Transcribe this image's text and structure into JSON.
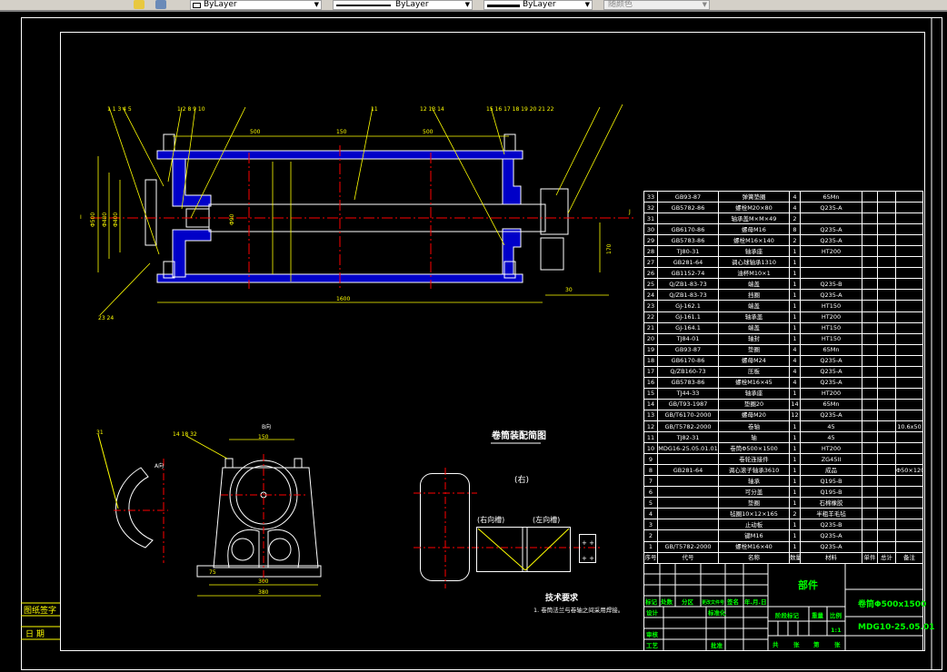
{
  "toolbar": {
    "layer_color": "ByLayer",
    "linetype": "ByLayer",
    "lineweight": "ByLayer",
    "plot_style": "随颜色"
  },
  "side_stamp": {
    "sign_label": "图纸签字",
    "date_label": "日 期"
  },
  "main_view": {
    "dims": {
      "left_half": "500",
      "mid": "150",
      "right_half": "500",
      "overall": "1600",
      "d1": "Φ500",
      "d2": "Φ480",
      "d3": "Φ400",
      "shaft": "Φ90",
      "right_len": "30",
      "right_h": "170"
    },
    "section_marks": {
      "left": "I",
      "right": "J"
    }
  },
  "bearing_view": {
    "title": "B向",
    "balloons": "14 18 32",
    "dim_top": "150",
    "dim_inner": "300",
    "dim_outer": "380",
    "dim_foot": "75"
  },
  "arc_view": {
    "balloon": "31",
    "label": "A向"
  },
  "assembly_sketch": {
    "title": "卷筒装配简图",
    "side": "(右)",
    "right_groove": "(右向槽)",
    "left_groove": "(左向槽)"
  },
  "tech_requirements": {
    "title": "技术要求",
    "items": [
      "1. 卷筒法兰与卷轴之间采用焊接。"
    ]
  },
  "parts_table": {
    "header": [
      "序号",
      "代号",
      "名称",
      "数量",
      "材料",
      "单件",
      "总计",
      "备注"
    ],
    "header_weight": "重量",
    "rows": [
      [
        "33",
        "GB93-87",
        "弹簧垫圈",
        "4",
        "65Mn",
        "",
        "",
        ""
      ],
      [
        "32",
        "GB5782-86",
        "螺栓M20×80",
        "4",
        "Q235-A",
        "",
        "",
        ""
      ],
      [
        "31",
        "",
        "轴承盖M×M×49",
        "2",
        "",
        "",
        "",
        ""
      ],
      [
        "30",
        "GB6170-86",
        "螺母M16",
        "8",
        "Q235-A",
        "",
        "",
        ""
      ],
      [
        "29",
        "GB5783-86",
        "螺栓M16×140",
        "2",
        "Q235-A",
        "",
        "",
        ""
      ],
      [
        "28",
        "TJ80-31",
        "轴承座",
        "1",
        "HT200",
        "",
        "",
        ""
      ],
      [
        "27",
        "GB281-64",
        "调心球轴承1310",
        "1",
        "",
        "",
        "",
        ""
      ],
      [
        "26",
        "GB1152-74",
        "油杯M10×1",
        "1",
        "",
        "",
        "",
        ""
      ],
      [
        "25",
        "Q/ZB1-83-73",
        "端盖",
        "1",
        "Q235-B",
        "",
        "",
        ""
      ],
      [
        "24",
        "Q/ZB1-83-73",
        "挡圈",
        "1",
        "Q235-A",
        "",
        "",
        ""
      ],
      [
        "23",
        "GJ-162.1",
        "端盖",
        "1",
        "HT150",
        "",
        "",
        ""
      ],
      [
        "22",
        "GJ-161.1",
        "轴承盖",
        "1",
        "HT200",
        "",
        "",
        ""
      ],
      [
        "21",
        "GJ-164.1",
        "端盖",
        "1",
        "HT150",
        "",
        "",
        ""
      ],
      [
        "20",
        "TJ84-01",
        "轴封",
        "1",
        "HT150",
        "",
        "",
        ""
      ],
      [
        "19",
        "GB93-87",
        "垫圈",
        "4",
        "65Mn",
        "",
        "",
        ""
      ],
      [
        "18",
        "GB6170-86",
        "螺母M24",
        "4",
        "Q235-A",
        "",
        "",
        ""
      ],
      [
        "17",
        "Q/ZB160-73",
        "压板",
        "4",
        "Q235-A",
        "",
        "",
        ""
      ],
      [
        "16",
        "GB5783-86",
        "螺栓M16×45",
        "4",
        "Q235-A",
        "",
        "",
        ""
      ],
      [
        "15",
        "TJ44-33",
        "轴承座",
        "1",
        "HT200",
        "",
        "",
        ""
      ],
      [
        "14",
        "GB/T93-1987",
        "垫圈20",
        "14",
        "65Mn",
        "",
        "",
        ""
      ],
      [
        "13",
        "GB/T6170-2000",
        "螺母M20",
        "12",
        "Q235-A",
        "",
        "",
        ""
      ],
      [
        "12",
        "GB/T5782-2000",
        "卷轴",
        "1",
        "45",
        "",
        "",
        "10.6x50"
      ],
      [
        "11",
        "TJ82-31",
        "轴",
        "1",
        "45",
        "",
        "",
        ""
      ],
      [
        "10",
        "MDG16-25.05.01.01",
        "卷筒Φ500×1500",
        "1",
        "HT200",
        "",
        "",
        ""
      ],
      [
        "9",
        "",
        "卷轮连接件",
        "1",
        "ZG45II",
        "",
        "",
        ""
      ],
      [
        "8",
        "GB281-64",
        "调心滚子轴承3610",
        "1",
        "成品",
        "",
        "",
        "Φ50×120×29"
      ],
      [
        "7",
        "",
        "轴承",
        "1",
        "Q195-B",
        "",
        "",
        ""
      ],
      [
        "6",
        "",
        "可分盖",
        "1",
        "Q195-B",
        "",
        "",
        ""
      ],
      [
        "5",
        "",
        "垫圈",
        "1",
        "石棉橡胶",
        "",
        "",
        ""
      ],
      [
        "4",
        "",
        "毡圈10×12×165",
        "2",
        "半粗羊毛毡",
        "",
        "",
        ""
      ],
      [
        "3",
        "",
        "止动板",
        "1",
        "Q235-B",
        "",
        "",
        ""
      ],
      [
        "2",
        "",
        "键M16",
        "1",
        "Q235-A",
        "",
        "",
        ""
      ],
      [
        "1",
        "GB/T5782-2000",
        "螺栓M16×40",
        "1",
        "Q235-A",
        "",
        "",
        ""
      ]
    ]
  },
  "title_block": {
    "part_type": "部件",
    "drawing_name": "卷筒Φ500x1500",
    "drawing_number": "MDG10-25.05.01",
    "mark": "标记",
    "count": "处数",
    "zone": "分区",
    "change_doc": "更改文件号",
    "signature": "签名",
    "date": "年.月.日",
    "design": "设计",
    "standardization": "标准化",
    "stage_mark": "阶段标记",
    "weight": "重量",
    "scale_label": "比例",
    "scale": "1:1",
    "review": "审核",
    "process": "工艺",
    "approve": "批准",
    "sheets": "共",
    "sheets_unit": "张",
    "sheet_no": "第",
    "sheet_unit": "张"
  },
  "colors": {
    "background": "#000000",
    "lines": "#ffffff",
    "dimensions": "#ffff00",
    "centerlines": "#ff0000",
    "hatch": "#0000ff",
    "title_text": "#00ff00"
  }
}
